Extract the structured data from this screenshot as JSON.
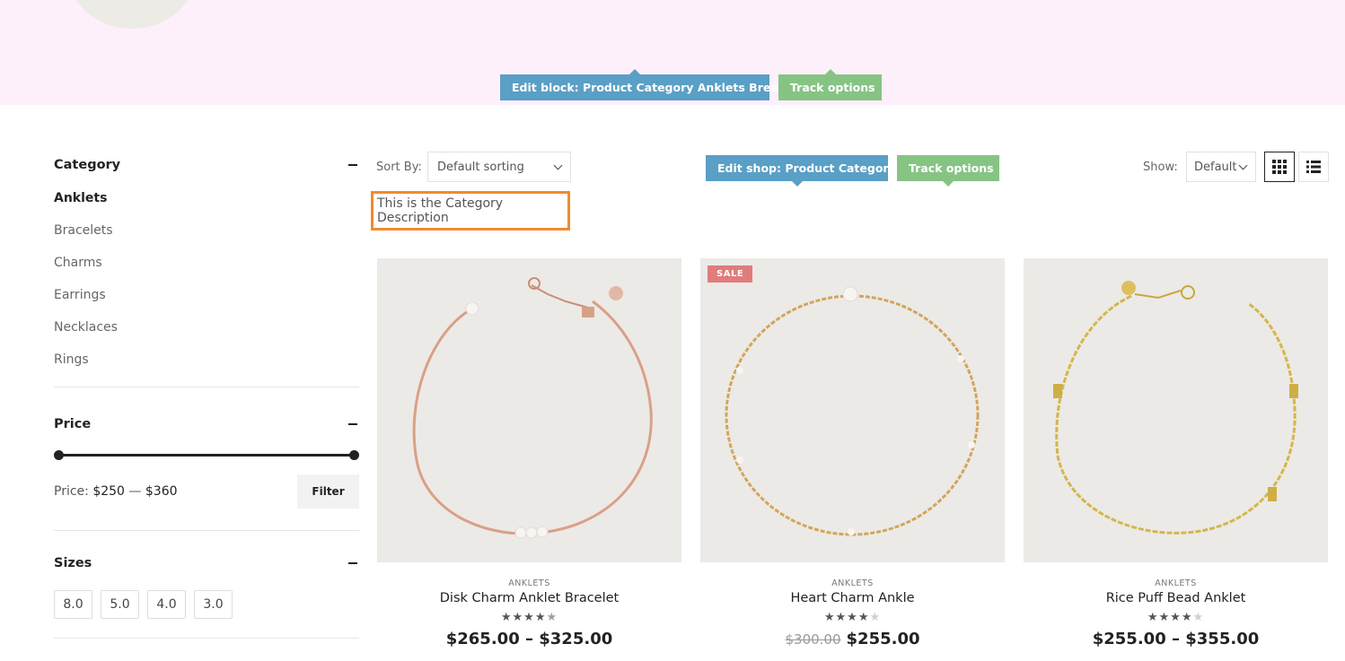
{
  "edit_block": {
    "label": "Edit block: Product Category Anklets Brea...",
    "track": "Track options"
  },
  "edit_shop": {
    "label": "Edit shop: Product Category",
    "track": "Track options"
  },
  "sidebar": {
    "category": {
      "title": "Category",
      "items": [
        {
          "label": "Anklets",
          "active": true
        },
        {
          "label": "Bracelets"
        },
        {
          "label": "Charms"
        },
        {
          "label": "Earrings"
        },
        {
          "label": "Necklaces"
        },
        {
          "label": "Rings"
        }
      ]
    },
    "price": {
      "title": "Price",
      "prefix": "Price:",
      "min": "$250",
      "sep": "—",
      "max": "$360",
      "filter_label": "Filter"
    },
    "sizes": {
      "title": "Sizes",
      "items": [
        "8.0",
        "5.0",
        "4.0",
        "3.0"
      ]
    }
  },
  "toolbar": {
    "sort_label": "Sort By:",
    "sort_value": "Default sorting",
    "show_label": "Show:",
    "show_value": "Default"
  },
  "category_description": "This is the Category Description",
  "products": [
    {
      "category": "ANKLETS",
      "name": "Disk Charm Anklet Bracelet",
      "rating": 4.5,
      "price": "$265.00 – $325.00",
      "old_price": "",
      "sale": false
    },
    {
      "category": "ANKLETS",
      "name": "Heart Charm Ankle",
      "rating": 4,
      "price": "$255.00",
      "old_price": "$300.00",
      "sale": true,
      "sale_label": "SALE"
    },
    {
      "category": "ANKLETS",
      "name": "Rice Puff Bead Anklet",
      "rating": 4,
      "price": "$255.00 – $355.00",
      "old_price": "",
      "sale": false
    }
  ],
  "colors": {
    "accent_blue": "#5a9fc6",
    "accent_green": "#86c484",
    "highlight": "#f28a2e",
    "sale": "#e07c7c"
  }
}
